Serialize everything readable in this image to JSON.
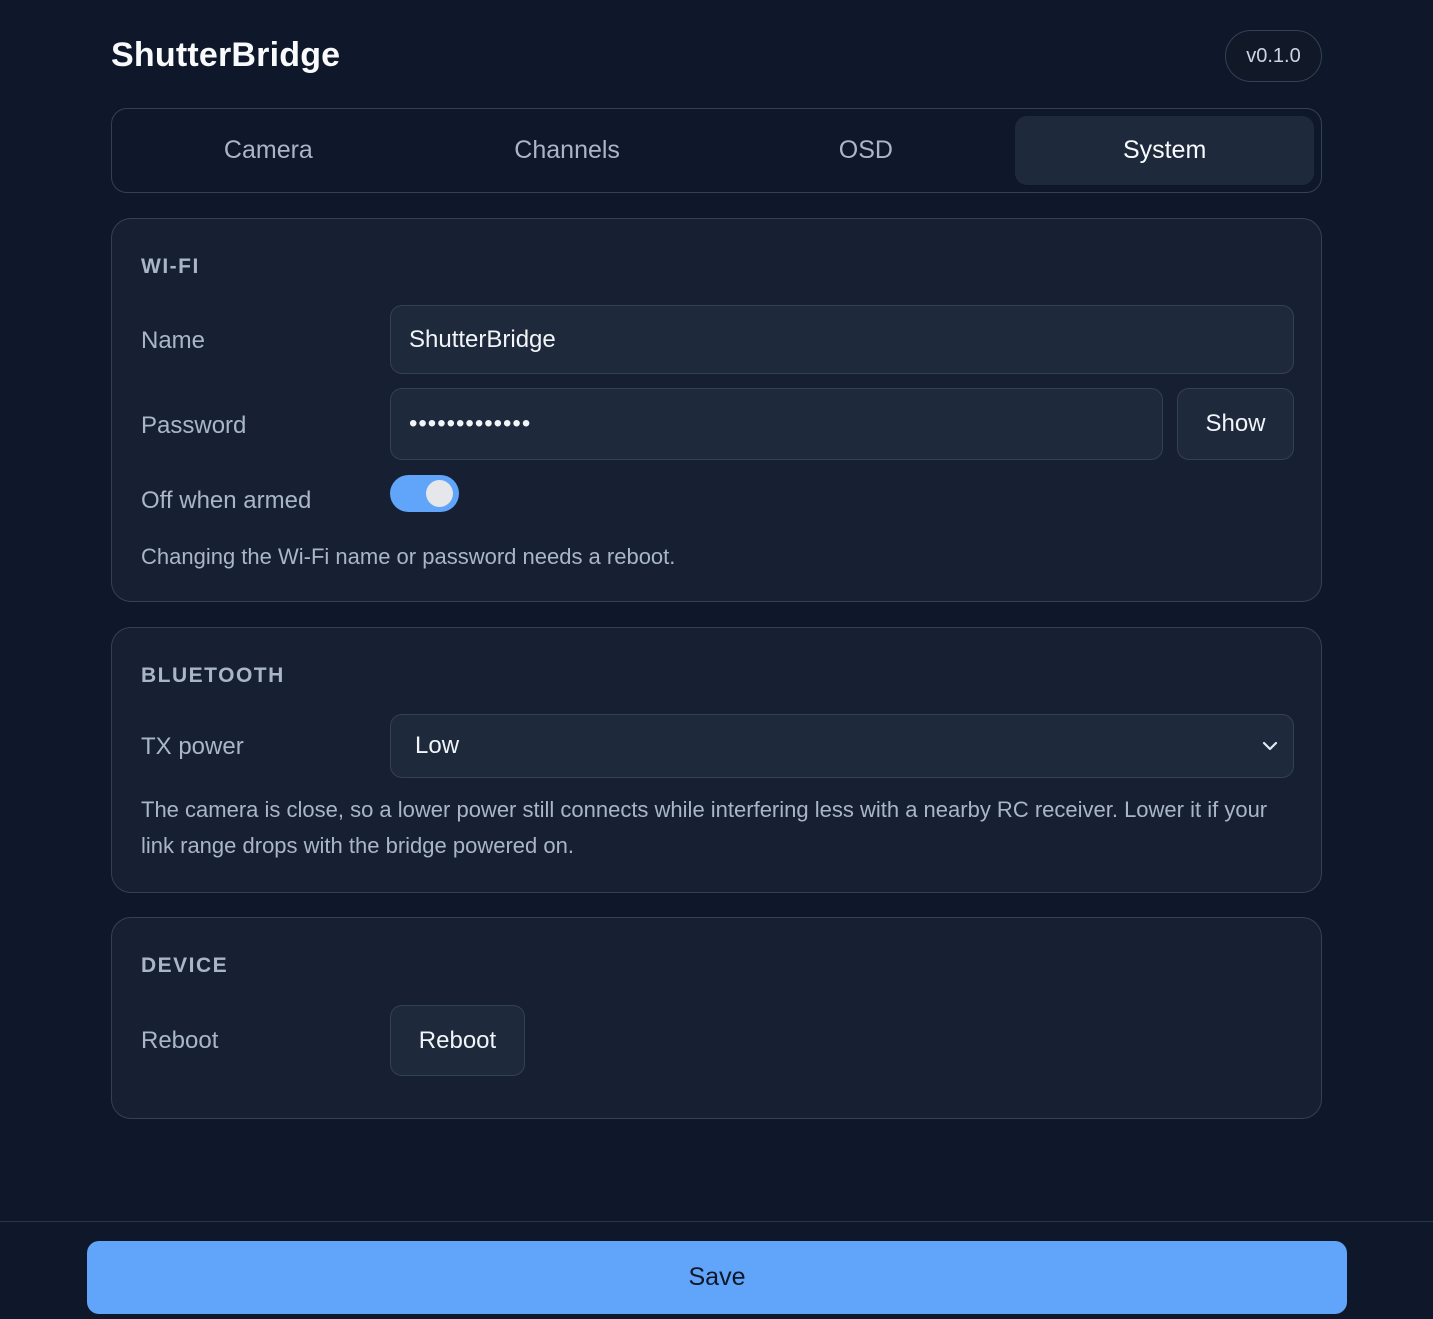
{
  "header": {
    "title": "ShutterBridge",
    "version": "v0.1.0"
  },
  "tabs": [
    {
      "label": "Camera",
      "active": false
    },
    {
      "label": "Channels",
      "active": false
    },
    {
      "label": "OSD",
      "active": false
    },
    {
      "label": "System",
      "active": true
    }
  ],
  "wifi": {
    "section_title": "WI-FI",
    "name_label": "Name",
    "name_value": "ShutterBridge",
    "password_label": "Password",
    "password_value": "•••••••••••••",
    "show_label": "Show",
    "off_when_armed_label": "Off when armed",
    "off_when_armed_enabled": true,
    "help": "Changing the Wi-Fi name or password needs a reboot."
  },
  "bluetooth": {
    "section_title": "BLUETOOTH",
    "tx_power_label": "TX power",
    "tx_power_value": "Low",
    "help": "The camera is close, so a lower power still connects while interfering less with a nearby RC receiver. Lower it if your link range drops with the bridge powered on."
  },
  "device": {
    "section_title": "DEVICE",
    "reboot_label": "Reboot",
    "reboot_button": "Reboot"
  },
  "footer": {
    "save_label": "Save"
  },
  "colors": {
    "background": "#0f172a",
    "card": "#172033",
    "accent": "#60a5fa"
  }
}
